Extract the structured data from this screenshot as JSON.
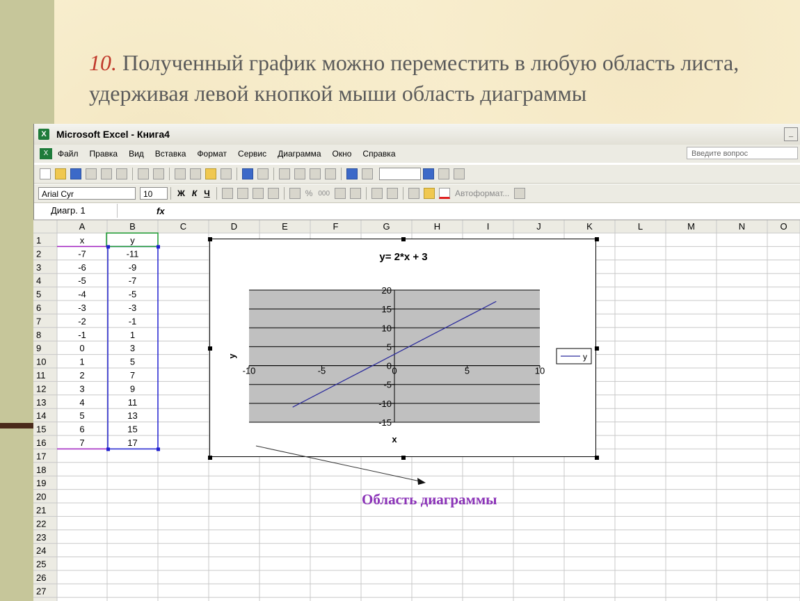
{
  "slide": {
    "number": "10.",
    "text": "Полученный график можно переместить в любую область листа, удерживая левой кнопкой мыши область диаграммы",
    "note_label": "Область диаграммы"
  },
  "window": {
    "title": "Microsoft Excel - Книга4"
  },
  "menu": {
    "items": [
      "Файл",
      "Правка",
      "Вид",
      "Вставка",
      "Формат",
      "Сервис",
      "Диаграмма",
      "Окно",
      "Справка"
    ],
    "ask_placeholder": "Введите вопрос"
  },
  "format_toolbar": {
    "font": "Arial Cyr",
    "size": "10",
    "bold": "Ж",
    "italic": "К",
    "underline": "Ч",
    "percent": "%",
    "thousands": "000",
    "autoformat": "Автоформат..."
  },
  "formula_bar": {
    "name_box": "Диагр. 1",
    "fx": "fx"
  },
  "sheet": {
    "columns": [
      "A",
      "B",
      "C",
      "D",
      "E",
      "F",
      "G",
      "H",
      "I",
      "J",
      "K",
      "L",
      "M",
      "N",
      "O"
    ],
    "rows": [
      [
        "x",
        "y"
      ],
      [
        "-7",
        "-11"
      ],
      [
        "-6",
        "-9"
      ],
      [
        "-5",
        "-7"
      ],
      [
        "-4",
        "-5"
      ],
      [
        "-3",
        "-3"
      ],
      [
        "-2",
        "-1"
      ],
      [
        "-1",
        "1"
      ],
      [
        "0",
        "3"
      ],
      [
        "1",
        "5"
      ],
      [
        "2",
        "7"
      ],
      [
        "3",
        "9"
      ],
      [
        "4",
        "11"
      ],
      [
        "5",
        "13"
      ],
      [
        "6",
        "15"
      ],
      [
        "7",
        "17"
      ]
    ],
    "row_count": 27
  },
  "chart_data": {
    "type": "line",
    "title": "y= 2*x + 3",
    "xlabel": "x",
    "ylabel": "y",
    "x": [
      -7,
      -6,
      -5,
      -4,
      -3,
      -2,
      -1,
      0,
      1,
      2,
      3,
      4,
      5,
      6,
      7
    ],
    "series": [
      {
        "name": "y",
        "values": [
          -11,
          -9,
          -7,
          -5,
          -3,
          -1,
          1,
          3,
          5,
          7,
          9,
          11,
          13,
          15,
          17
        ],
        "color": "#2c2c9c"
      }
    ],
    "xlim": [
      -10,
      10
    ],
    "ylim": [
      -15,
      20
    ],
    "x_ticks": [
      "-10",
      "-5",
      "0",
      "5",
      "10"
    ],
    "y_ticks": [
      "20",
      "15",
      "10",
      "5",
      "0",
      "-5",
      "-10",
      "-15"
    ],
    "grid": true,
    "plot_bg": "#c0c0c0",
    "legend": "right"
  }
}
